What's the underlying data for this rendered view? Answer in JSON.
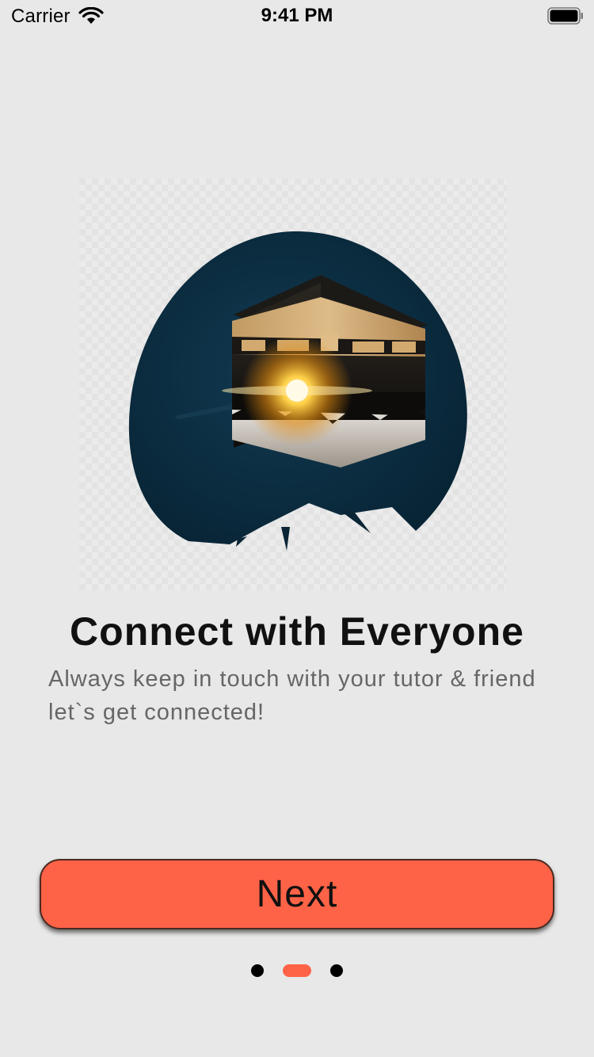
{
  "status_bar": {
    "carrier": "Carrier",
    "time": "9:41 PM",
    "wifi_icon": "wifi-icon",
    "battery_icon": "battery-full-icon"
  },
  "onboarding": {
    "image": "kaaba-illustration",
    "title": "Connect with Everyone",
    "subtitle": "Always keep in touch with your tutor & friend let`s get connected!",
    "next_label": "Next",
    "page_indicator": {
      "pages": 3,
      "current": 2
    }
  },
  "colors": {
    "background": "#e8e8e8",
    "accent": "#ff6347",
    "title": "#111111",
    "subtitle": "#666666"
  }
}
